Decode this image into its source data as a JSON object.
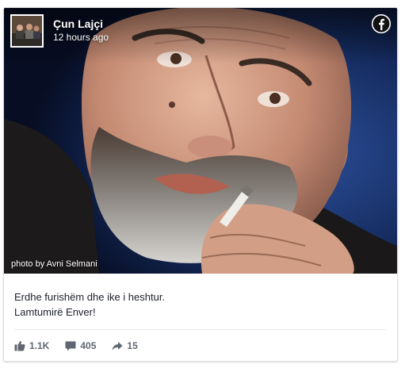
{
  "post": {
    "author": "Çun Lajçi",
    "time": "12 hours ago",
    "photo_credit": "photo by Avni Selmani",
    "caption_lines": [
      "Erdhe furishëm dhe ike i heshtur.",
      "Lamtumirë Enver!"
    ]
  },
  "stats": {
    "likes": "1.1K",
    "comments": "405",
    "shares": "15"
  },
  "icons": {
    "brand": "facebook-icon",
    "like": "thumbs-up-icon",
    "comment": "comment-icon",
    "share": "share-icon"
  },
  "colors": {
    "brand": "#1877f2",
    "stat_text": "#606770",
    "caption_text": "#1d2129"
  }
}
